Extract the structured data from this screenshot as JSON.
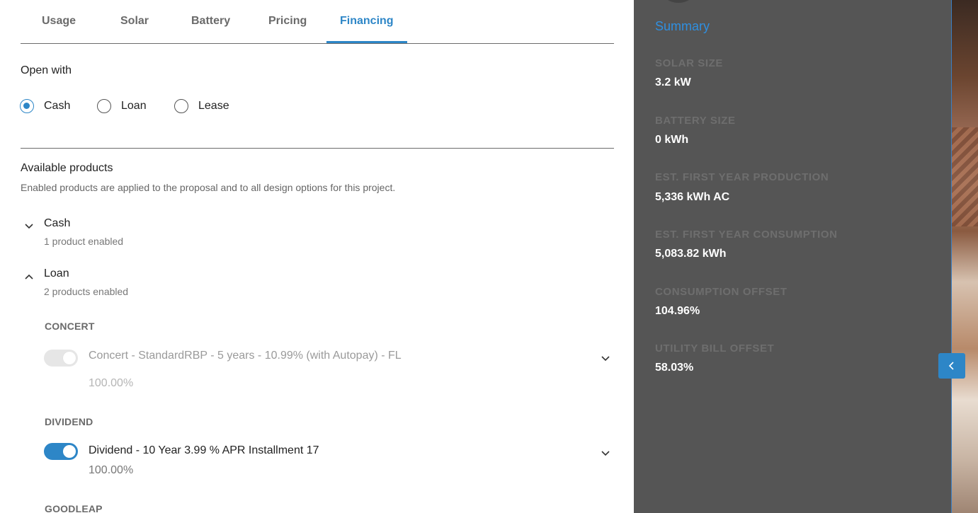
{
  "tabs": [
    {
      "label": "Usage"
    },
    {
      "label": "Solar"
    },
    {
      "label": "Battery"
    },
    {
      "label": "Pricing"
    },
    {
      "label": "Financing",
      "active": true
    }
  ],
  "open_with": {
    "title": "Open with",
    "options": [
      {
        "label": "Cash",
        "checked": true
      },
      {
        "label": "Loan",
        "checked": false
      },
      {
        "label": "Lease",
        "checked": false
      }
    ]
  },
  "available": {
    "title": "Available products",
    "subtitle": "Enabled products are applied to the proposal and to all design options for this project.",
    "groups": [
      {
        "label": "Cash",
        "sub": "1 product enabled",
        "expanded": false
      },
      {
        "label": "Loan",
        "sub": "2 products enabled",
        "expanded": true
      }
    ],
    "providers": [
      {
        "name": "CONCERT",
        "product": "Concert - StandardRBP - 5 years - 10.99% (with Autopay) - FL",
        "percent": "100.00%",
        "enabled": false
      },
      {
        "name": "DIVIDEND",
        "product": "Dividend - 10 Year 3.99 % APR Installment 17",
        "percent": "100.00%",
        "enabled": true
      },
      {
        "name": "GOODLEAP"
      }
    ]
  },
  "summary": {
    "title": "Summary",
    "items": [
      {
        "label": "SOLAR SIZE",
        "value": "3.2 kW"
      },
      {
        "label": "BATTERY SIZE",
        "value": "0 kWh"
      },
      {
        "label": "EST. FIRST YEAR PRODUCTION",
        "value": "5,336 kWh AC"
      },
      {
        "label": "EST. FIRST YEAR CONSUMPTION",
        "value": "5,083.82 kWh"
      },
      {
        "label": "CONSUMPTION OFFSET",
        "value": "104.96%"
      },
      {
        "label": "UTILITY BILL OFFSET",
        "value": "58.03%"
      }
    ]
  },
  "colors": {
    "accent": "#2d86c7",
    "summary_bg": "#555555",
    "summary_title": "#2f8fe0"
  },
  "icons": {
    "collapse": "chevron-left-icon",
    "expand": "chevron-down-icon",
    "collapse_group": "chevron-up-icon"
  }
}
